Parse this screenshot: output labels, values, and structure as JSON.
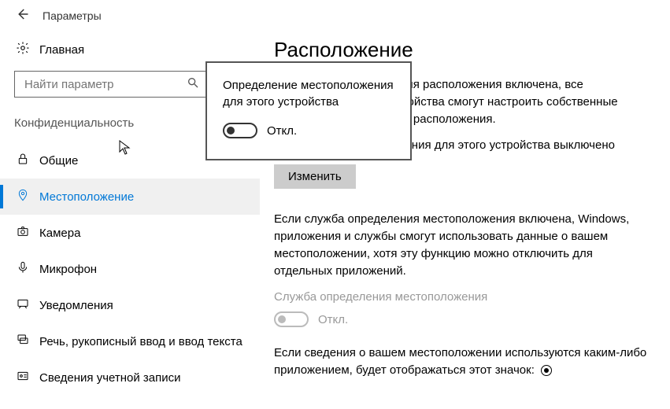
{
  "titlebar": {
    "title": "Параметры"
  },
  "left": {
    "home": "Главная",
    "search_placeholder": "Найти параметр",
    "category": "Конфиденциальность",
    "nav": [
      {
        "label": "Общие"
      },
      {
        "label": "Местоположение"
      },
      {
        "label": "Камера"
      },
      {
        "label": "Микрофон"
      },
      {
        "label": "Уведомления"
      },
      {
        "label": "Речь, рукописный ввод и ввод текста"
      },
      {
        "label": "Сведения учетной записи"
      }
    ]
  },
  "right": {
    "heading": "Расположение",
    "para1": "Если служба определения расположения включена, все пользователи этого устройства смогут настроить собственные параметры определения расположения.",
    "status": "Определение расположения для этого устройства выключено",
    "change_btn": "Изменить",
    "para2": "Если служба определения местоположения включена, Windows, приложения и службы смогут использовать данные о вашем местоположении, хотя эту функцию можно отключить для отдельных приложений.",
    "service_label": "Служба определения местоположения",
    "service_state": "Откл.",
    "para3": "Если сведения о вашем местоположении используются каким-либо приложением, будет отображаться этот значок:"
  },
  "flyout": {
    "title": "Определение местоположения для этого устройства",
    "state": "Откл."
  }
}
